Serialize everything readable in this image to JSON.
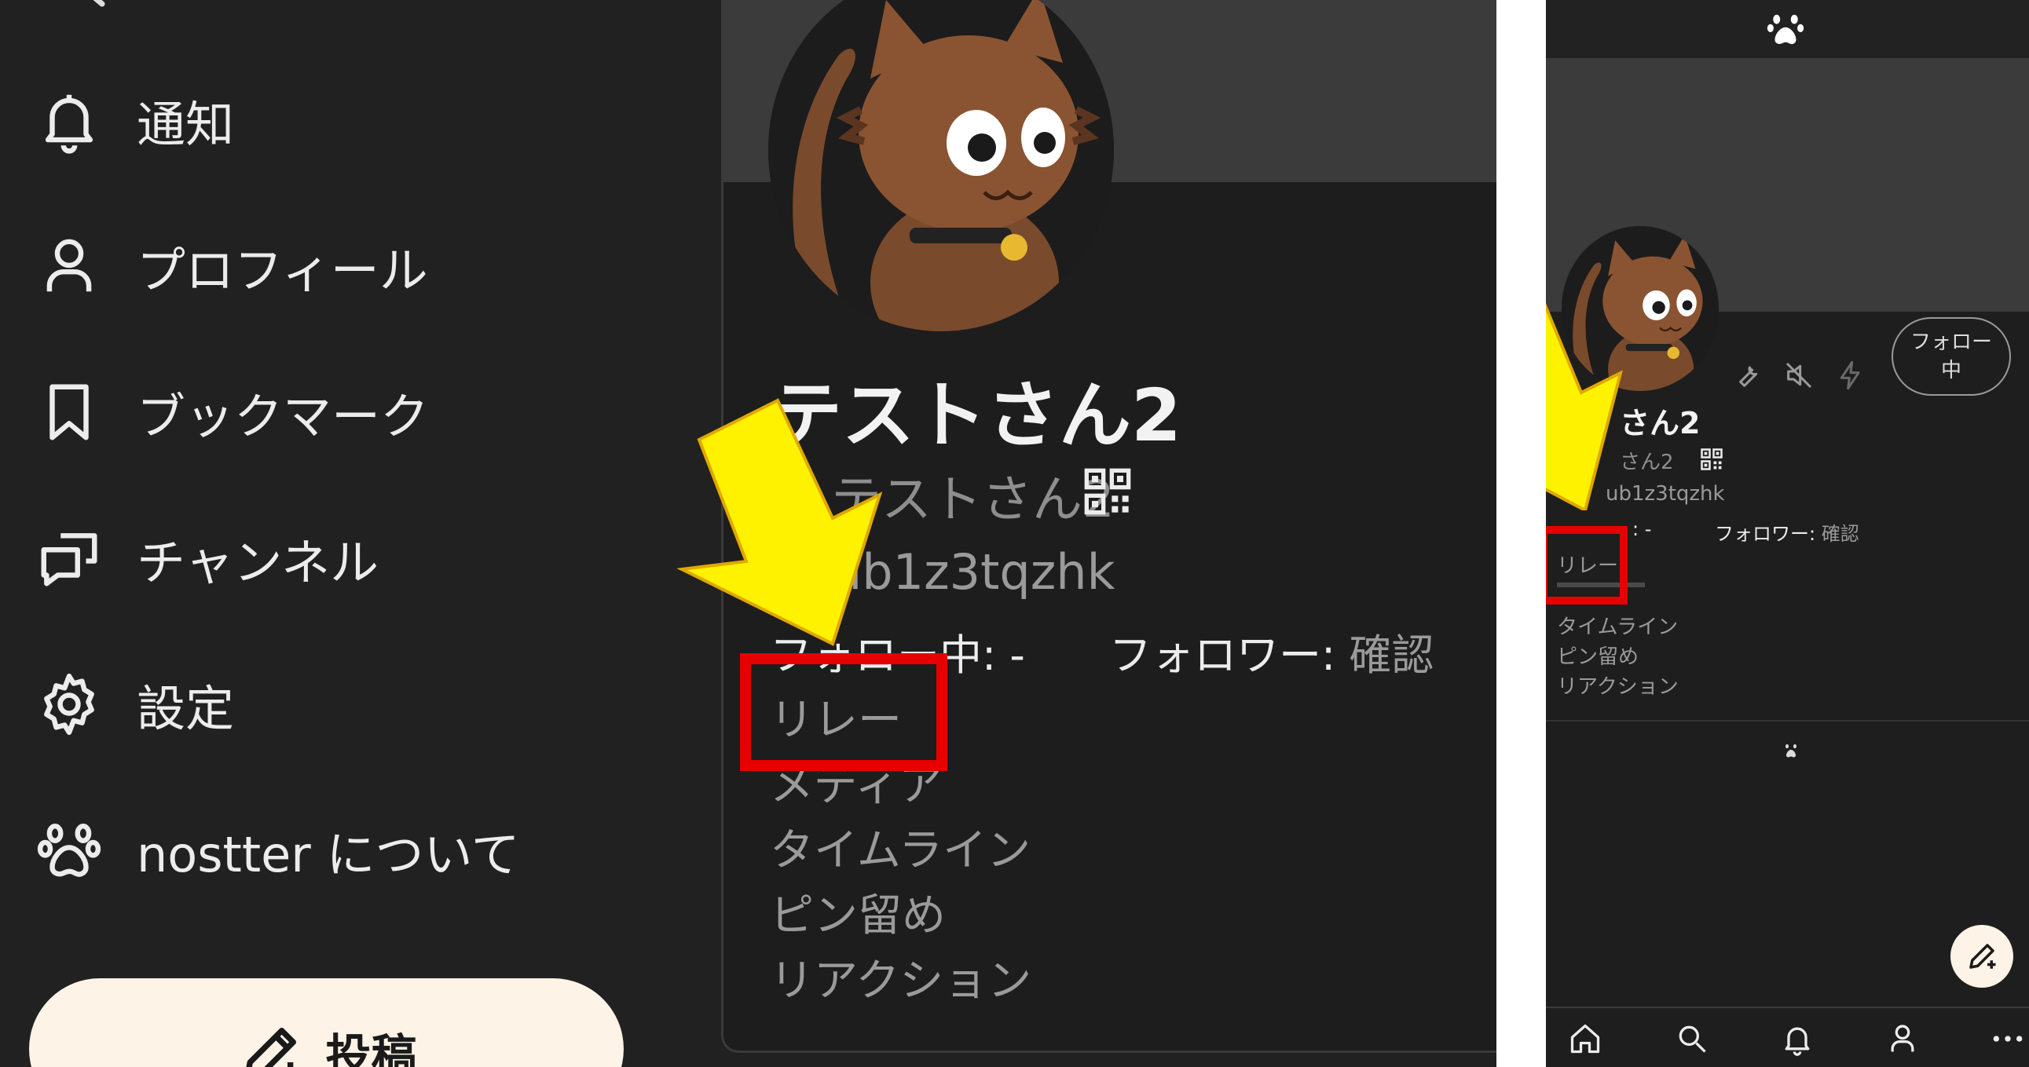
{
  "nav": {
    "items": [
      {
        "label": "通知",
        "icon": "bell-icon"
      },
      {
        "label": "プロフィール",
        "icon": "user-icon"
      },
      {
        "label": "ブックマーク",
        "icon": "bookmark-icon"
      },
      {
        "label": "チャンネル",
        "icon": "chat-icon"
      },
      {
        "label": "設定",
        "icon": "gear-icon"
      },
      {
        "label": "nostter について",
        "icon": "paw-icon"
      }
    ],
    "post_label": "投稿"
  },
  "profile_large": {
    "display_name": "テストさん2",
    "name": "テストさん2",
    "npub": "ub1z3tqzhk",
    "following_label": "フォロー中: -",
    "followers_label": "フォロワー:",
    "followers_action": "確認",
    "tabs": [
      "リレー",
      "メディア",
      "タイムライン",
      "ピン留め",
      "リアクション"
    ]
  },
  "profile_small": {
    "display_name": "さん2",
    "name": "さん2",
    "npub": "ub1z3tqzhk",
    "following_label": ": -",
    "followers_label": "フォロワー:",
    "followers_action": "確認",
    "follow_button": "フォロー中",
    "tabs": [
      "リレー",
      "タイムライン",
      "ピン留め",
      "リアクション"
    ]
  },
  "colors": {
    "background": "#212121",
    "highlight": "#e60000",
    "arrow": "#fff200",
    "post_button": "#fdf3e6"
  }
}
